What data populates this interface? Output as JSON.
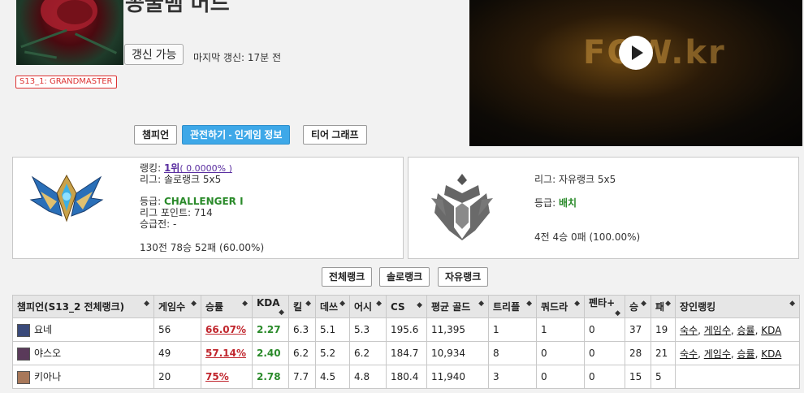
{
  "header": {
    "summoner_name": "꽁꿀뱀 머드",
    "refresh_label": "갱신 가능",
    "last_update": "마지막 갱신: 17분 전",
    "season_badge": "S13_1: GRANDMASTER"
  },
  "tabs": [
    {
      "label": "챔피언",
      "active": false
    },
    {
      "label": "관전하기 - 인게임 정보",
      "active": true
    },
    {
      "label": "티어 그래프",
      "active": false
    }
  ],
  "video": {
    "watermark": "FOW.kr"
  },
  "solo_rank": {
    "ranking_label": "랭킹:",
    "ranking_value": "1위",
    "ranking_pct": "( 0.0000% )",
    "league": "리그: 솔로랭크 5x5",
    "tier_label": "등급:",
    "tier_value": "CHALLENGER I",
    "league_points": "리그 포인트: 714",
    "promotion": "승급전: -",
    "record": "130전 78승 52패 (60.00%)"
  },
  "flex_rank": {
    "league": "리그: 자유랭크 5x5",
    "tier_label": "등급:",
    "tier_value": "배치",
    "record": "4전 4승 0패 (100.00%)"
  },
  "rank_buttons": [
    "전체랭크",
    "솔로랭크",
    "자유랭크"
  ],
  "table": {
    "headers": [
      "챔피언(S13_2 전체랭크)",
      "게임수",
      "승률",
      "KDA",
      "킬",
      "데쓰",
      "어시",
      "CS",
      "평균 골드",
      "트리플",
      "쿼드라",
      "펜타+",
      "승",
      "패",
      "장인랭킹"
    ],
    "rows": [
      {
        "champion": "요네",
        "icon_color": "#3a4a7a",
        "games": "56",
        "winrate": "66.07%",
        "kda": "2.27",
        "kills": "6.3",
        "deaths": "5.1",
        "assists": "5.3",
        "cs": "195.6",
        "gold": "11,395",
        "triple": "1",
        "quadra": "1",
        "penta": "0",
        "wins": "37",
        "losses": "19",
        "mastery": [
          "숙수",
          "게임수",
          "승률",
          "KDA"
        ]
      },
      {
        "champion": "야스오",
        "icon_color": "#5a3a5a",
        "games": "49",
        "winrate": "57.14%",
        "kda": "2.40",
        "kills": "6.2",
        "deaths": "5.2",
        "assists": "6.2",
        "cs": "184.7",
        "gold": "10,934",
        "triple": "8",
        "quadra": "0",
        "penta": "0",
        "wins": "28",
        "losses": "21",
        "mastery": [
          "숙수",
          "게임수",
          "승률",
          "KDA"
        ]
      },
      {
        "champion": "키아나",
        "icon_color": "#a8785a",
        "games": "20",
        "winrate": "75%",
        "kda": "2.78",
        "kills": "7.7",
        "deaths": "4.5",
        "assists": "4.8",
        "cs": "180.4",
        "gold": "11,940",
        "triple": "3",
        "quadra": "0",
        "penta": "0",
        "wins": "15",
        "losses": "5",
        "mastery": []
      }
    ]
  }
}
